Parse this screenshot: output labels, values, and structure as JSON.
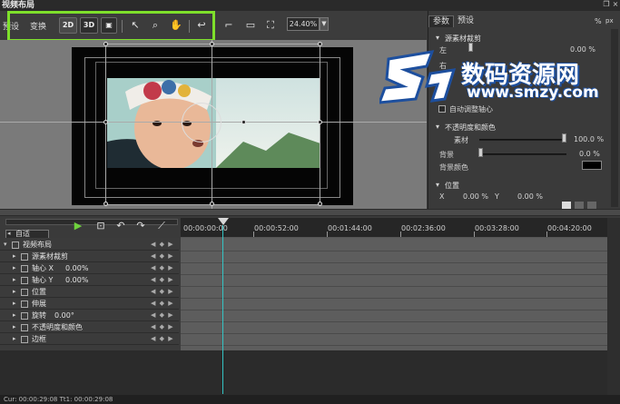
{
  "window": {
    "title": "视频布局"
  },
  "toolbar": {
    "preset_label": "预设",
    "transform_label": "变换",
    "btn_2d": "2D",
    "btn_3d": "3D",
    "zoom": "24.40%"
  },
  "panel": {
    "tabs": [
      "参数",
      "预设"
    ],
    "pct_label": "%",
    "px_label": "px",
    "crop": {
      "title": "源素材裁剪",
      "left_label": "左",
      "left_value": "0.00 %",
      "right_label": "右"
    },
    "auto_pivot_label": "自动调整轴心",
    "opacity": {
      "title": "不透明度和颜色",
      "material_label": "素材",
      "material_value": "100.0 %",
      "background_label": "背景",
      "background_value": "0.0 %",
      "bgcolor_label": "背景颜色",
      "bgcolor": "#000000"
    },
    "position": {
      "title": "位置",
      "x_label": "X",
      "x_value": "0.00 %",
      "y_label": "Y",
      "y_value": "0.00 %"
    }
  },
  "timeline": {
    "dropdown": "自适",
    "ruler_labels": [
      "00:00:00:00",
      "00:00:52:00",
      "00:01:44:00",
      "00:02:36:00",
      "00:03:28:00",
      "00:04:20:00"
    ],
    "tracks": [
      {
        "name": "视频布局",
        "value": ""
      },
      {
        "name": "源素材裁剪",
        "value": ""
      },
      {
        "name": "轴心 X",
        "value": "0.00%"
      },
      {
        "name": "轴心 Y",
        "value": "0.00%"
      },
      {
        "name": "位置",
        "value": ""
      },
      {
        "name": "伸展",
        "value": ""
      },
      {
        "name": "旋转",
        "value": "0.00°"
      },
      {
        "name": "不透明度和颜色",
        "value": ""
      },
      {
        "name": "边框",
        "value": ""
      }
    ],
    "keyframe_nav": "◀ ◆ ▶"
  },
  "status": {
    "text": "Cur: 00:00:29:08  Tt1: 00:00:29:08"
  },
  "watermark": {
    "title": "数码资源网",
    "url": "www.smzy.com"
  },
  "icons": [
    "play-icon",
    "undo-icon",
    "redo-icon",
    "select-arrow-icon",
    "zoom-icon",
    "hand-icon",
    "fit-icon"
  ]
}
